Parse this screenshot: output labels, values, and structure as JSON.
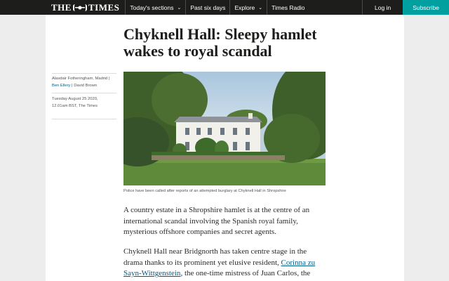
{
  "nav": {
    "brand_left": "THE",
    "brand_right": "TIMES",
    "sections_label": "Today's sections",
    "past_six_days_label": "Past six days",
    "explore_label": "Explore",
    "radio_label": "Times Radio",
    "login_label": "Log in",
    "subscribe_label": "Subscribe"
  },
  "article": {
    "headline": "Chyknell Hall: Sleepy hamlet wakes to royal scandal",
    "byline": {
      "author1": "Alasdair Fotheringham, Madrid |",
      "author2": "Ben Ellery",
      "separator": "|",
      "author3": "David Brown"
    },
    "date": "Tuesday August 25 2020,",
    "time_source": "12.01am BST, The Times",
    "image_caption": "Police have been called after reports of an attempted burglary at Chyknell Hall in Shropshire",
    "paragraph1": "A country estate in a Shropshire hamlet is at the centre of an international scandal involving the Spanish royal family, mysterious offshore companies and secret agents.",
    "paragraph2_start": "Chyknell Hall near Bridgnorth has taken centre stage in the drama thanks to its prominent yet elusive resident, ",
    "paragraph2_link": "Corinna zu Sayn-Wittgenstein",
    "paragraph2_end": ", the one-time mistress of Juan Carlos, the former King of Spain."
  },
  "colors": {
    "nav_background": "#1d1d1b",
    "subscribe": "#00a0a0",
    "link": "#005c8a",
    "page_background": "#ededed"
  },
  "icons": {
    "sections_chevron": "chevron-down-icon",
    "explore_chevron": "chevron-down-icon",
    "brand_crest": "royal-crest-icon"
  }
}
